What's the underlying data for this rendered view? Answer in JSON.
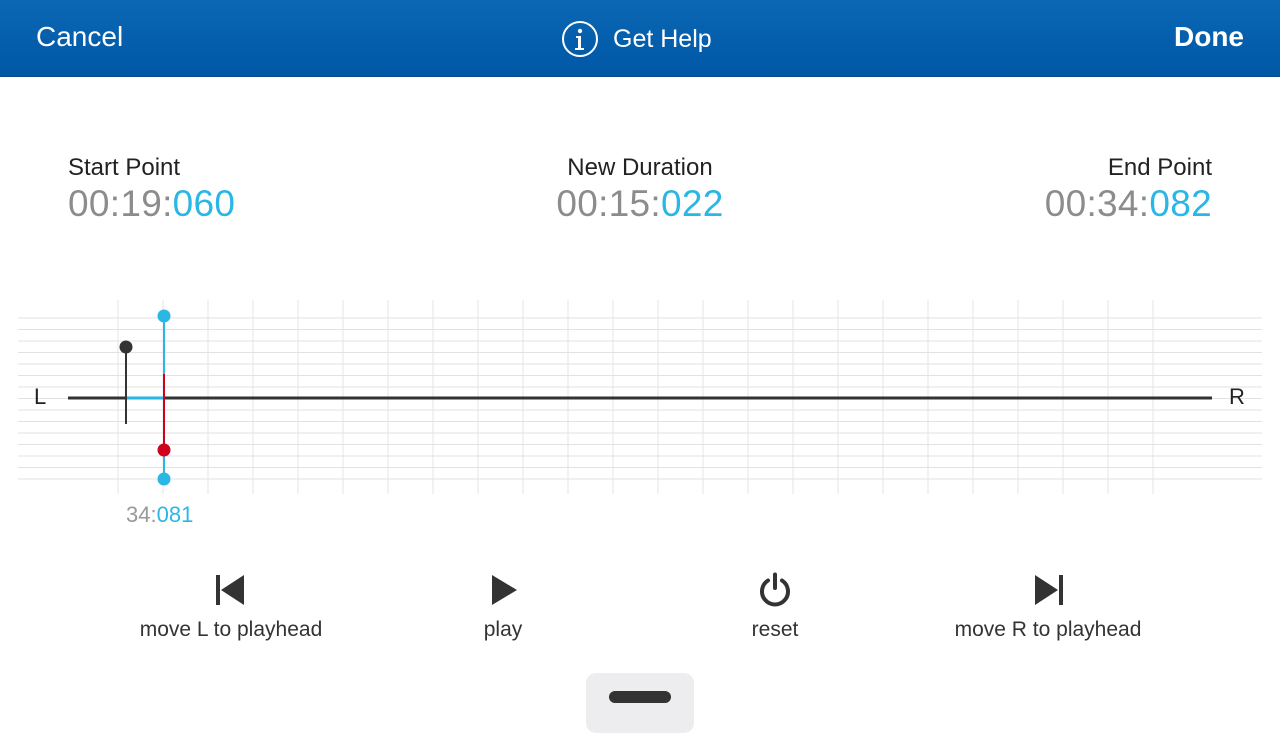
{
  "navbar": {
    "cancel_label": "Cancel",
    "help_label": "Get Help",
    "help_icon": "info-circle-icon",
    "done_label": "Done",
    "background_color": "#0a67b4"
  },
  "readouts": {
    "start": {
      "label": "Start Point",
      "time_main": "00:19:",
      "time_ms": "060"
    },
    "duration": {
      "label": "New Duration",
      "time_main": "00:15:",
      "time_ms": "022"
    },
    "end": {
      "label": "End Point",
      "time_main": "00:34:",
      "time_ms": "082"
    },
    "ms_color": "#2ab7e6"
  },
  "timeline": {
    "left_label": "L",
    "right_label": "R",
    "playhead_time_main": "34:",
    "playhead_time_ms": "081",
    "marker_colors": {
      "playhead": "#2ab7e6",
      "end_marker": "#d0021b",
      "start_marker": "#333333"
    }
  },
  "controls": [
    {
      "label": "move L to playhead",
      "icon": "skip-back-icon"
    },
    {
      "label": "play",
      "icon": "play-icon"
    },
    {
      "label": "reset",
      "icon": "power-icon"
    },
    {
      "label": "move R to playhead",
      "icon": "skip-forward-icon"
    }
  ]
}
